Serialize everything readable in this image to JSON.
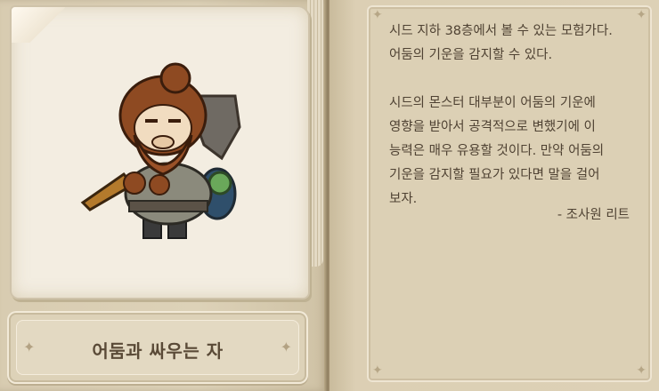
{
  "portrait": {
    "character_icon": "dwarf-warrior-icon"
  },
  "title": "어둠과 싸우는 자",
  "description": {
    "paragraph1": [
      "시드 지하 38층에서 볼 수 있는 모험가다.",
      "어둠의 기운을 감지할 수 있다."
    ],
    "paragraph2": [
      "시드의 몬스터 대부분이 어둠의 기운에",
      "영향을 받아서 공격적으로 변했기에 이",
      "능력은 매우 유용할 것이다. 만약 어둠의",
      "기운을 감지할 필요가 있다면 말을 걸어",
      "보자."
    ],
    "signature": "- 조사원 리트"
  },
  "colors": {
    "text": "#4f4233",
    "title": "#5a4a37",
    "parchment": "#dcd0b5"
  }
}
